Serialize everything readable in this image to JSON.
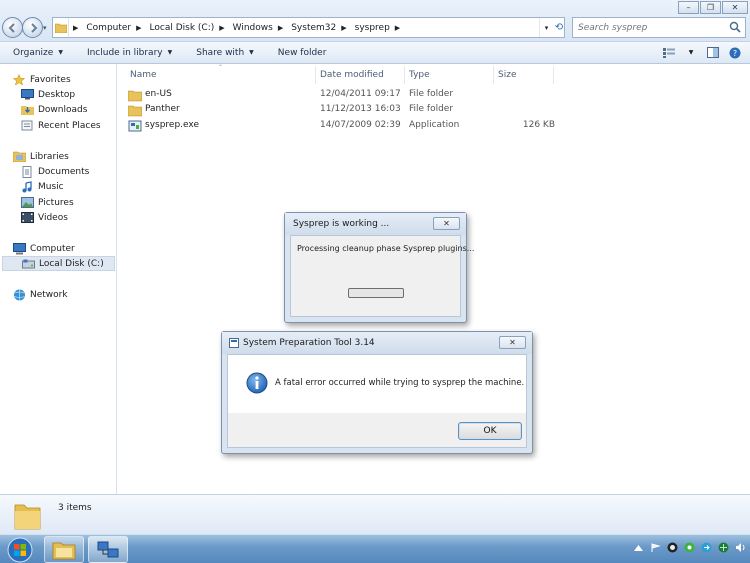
{
  "window": {
    "controls": {
      "minimize": "–",
      "maximize": "❐",
      "close": "✕"
    }
  },
  "address": {
    "crumbs": [
      "Computer",
      "Local Disk (C:)",
      "Windows",
      "System32",
      "sysprep"
    ],
    "search_placeholder": "Search sysprep"
  },
  "toolbar": {
    "organize": "Organize",
    "include_in_library": "Include in library",
    "share_with": "Share with",
    "new_folder": "New folder"
  },
  "nav": {
    "favorites": {
      "label": "Favorites",
      "items": [
        "Desktop",
        "Downloads",
        "Recent Places"
      ]
    },
    "libraries": {
      "label": "Libraries",
      "items": [
        "Documents",
        "Music",
        "Pictures",
        "Videos"
      ]
    },
    "computer": {
      "label": "Computer",
      "items": [
        "Local Disk (C:)"
      ]
    },
    "network": {
      "label": "Network"
    }
  },
  "columns": {
    "name": "Name",
    "date_modified": "Date modified",
    "type": "Type",
    "size": "Size"
  },
  "files": [
    {
      "name": "en-US",
      "date": "12/04/2011 09:17",
      "type": "File folder",
      "size": "",
      "icon": "folder-icon"
    },
    {
      "name": "Panther",
      "date": "11/12/2013 16:03",
      "type": "File folder",
      "size": "",
      "icon": "folder-icon"
    },
    {
      "name": "sysprep.exe",
      "date": "14/07/2009 02:39",
      "type": "Application",
      "size": "126 KB",
      "icon": "application-icon"
    }
  ],
  "status": {
    "items_count": "3 items"
  },
  "dialog_working": {
    "title": "Sysprep is working ...",
    "message": "Processing cleanup phase Sysprep plugins...",
    "progress": 0,
    "close": "✕"
  },
  "dialog_error": {
    "title": "System Preparation Tool 3.14",
    "message": "A fatal error occurred while trying to sysprep the machine.",
    "ok": "OK",
    "close": "✕"
  },
  "colors": {
    "accent": "#2a6db8",
    "selection": "#dfe8f2",
    "taskbar": "#6c9bc8"
  }
}
